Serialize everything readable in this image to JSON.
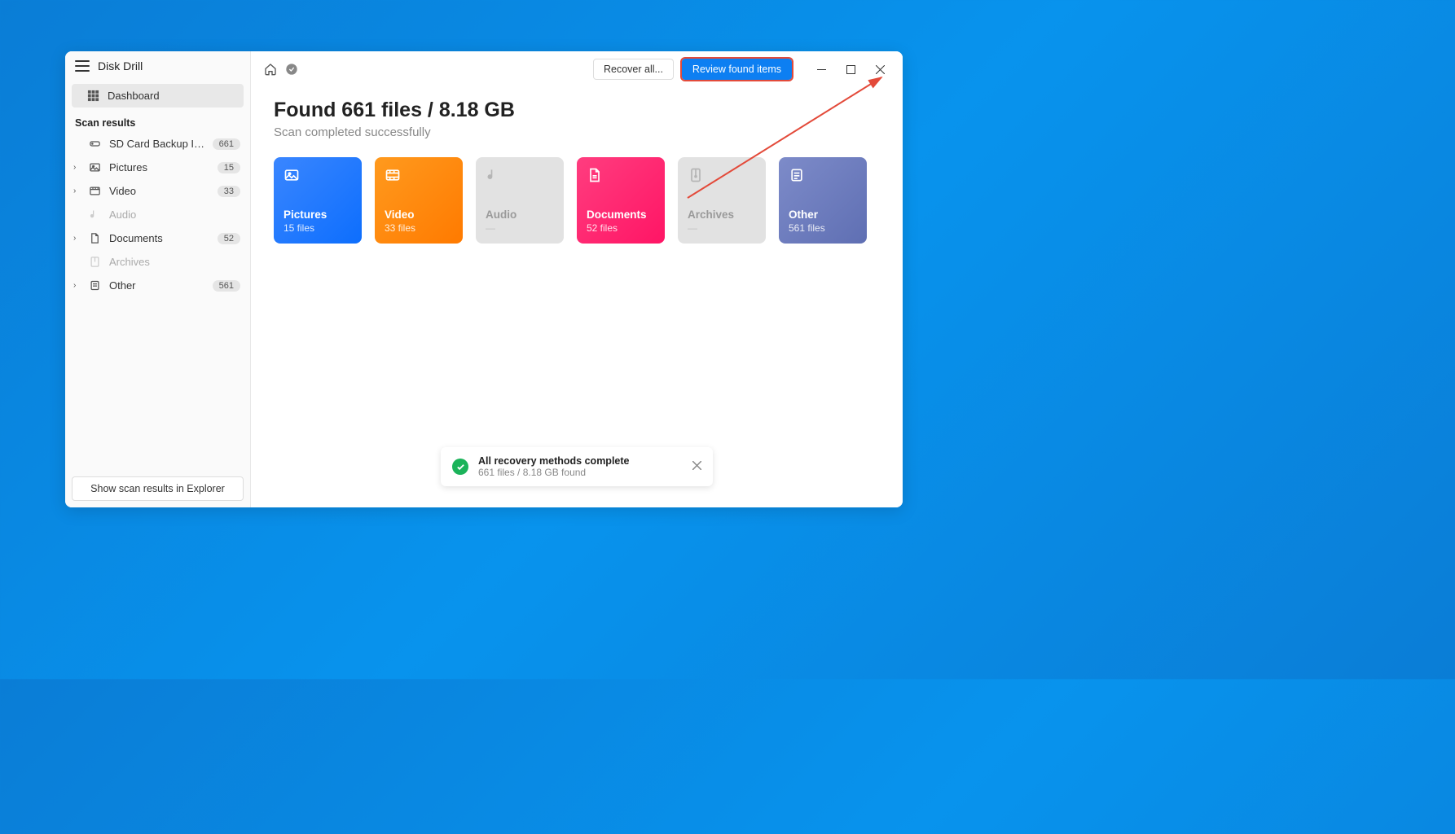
{
  "app": {
    "title": "Disk Drill"
  },
  "sidebar": {
    "dashboard": "Dashboard",
    "section_label": "Scan results",
    "items": [
      {
        "label": "SD Card Backup Image.d…",
        "count": "661",
        "icon": "drive",
        "expandable": false,
        "muted": false
      },
      {
        "label": "Pictures",
        "count": "15",
        "icon": "picture",
        "expandable": true,
        "muted": false
      },
      {
        "label": "Video",
        "count": "33",
        "icon": "video",
        "expandable": true,
        "muted": false
      },
      {
        "label": "Audio",
        "count": "",
        "icon": "audio",
        "expandable": false,
        "muted": true
      },
      {
        "label": "Documents",
        "count": "52",
        "icon": "document",
        "expandable": true,
        "muted": false
      },
      {
        "label": "Archives",
        "count": "",
        "icon": "archive",
        "expandable": false,
        "muted": true
      },
      {
        "label": "Other",
        "count": "561",
        "icon": "other",
        "expandable": true,
        "muted": false
      }
    ],
    "footer_button": "Show scan results in Explorer"
  },
  "toolbar": {
    "recover_all": "Recover all...",
    "review": "Review found items"
  },
  "summary": {
    "headline": "Found 661 files / 8.18 GB",
    "subhead": "Scan completed successfully"
  },
  "cards": [
    {
      "key": "pictures",
      "label": "Pictures",
      "count": "15 files",
      "variant": "pictures"
    },
    {
      "key": "video",
      "label": "Video",
      "count": "33 files",
      "variant": "video"
    },
    {
      "key": "audio",
      "label": "Audio",
      "count": "—",
      "variant": "muted"
    },
    {
      "key": "documents",
      "label": "Documents",
      "count": "52 files",
      "variant": "documents"
    },
    {
      "key": "archives",
      "label": "Archives",
      "count": "—",
      "variant": "muted"
    },
    {
      "key": "other",
      "label": "Other",
      "count": "561 files",
      "variant": "other"
    }
  ],
  "toast": {
    "title": "All recovery methods complete",
    "sub": "661 files / 8.18 GB found"
  }
}
